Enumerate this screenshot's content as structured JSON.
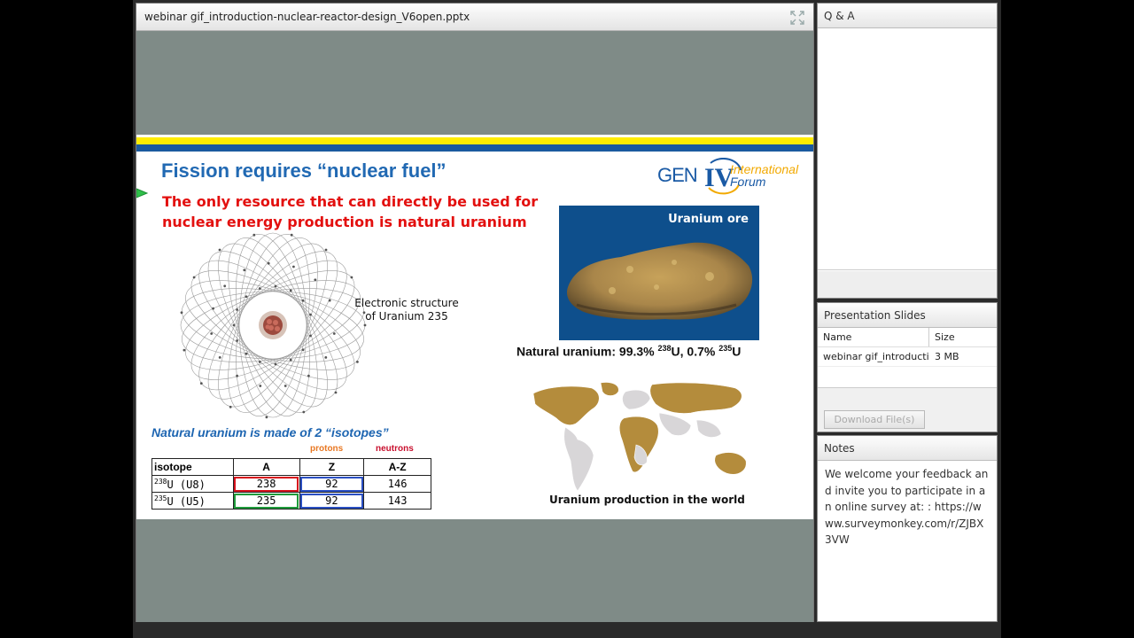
{
  "share_pod": {
    "title": "webinar gif_introduction-nuclear-reactor-design_V6open.pptx"
  },
  "slide": {
    "title": "Fission requires “nuclear fuel”",
    "subtitle": "The only resource that can directly be used for nuclear energy production is natural uranium",
    "logo": {
      "gen": "GEN",
      "roman": "IV",
      "line1": "International",
      "line2": "Forum"
    },
    "electronic_label_line1": "Electronic structure",
    "electronic_label_line2": "of Uranium 235",
    "ore_label": "Uranium ore",
    "natural_caption": {
      "prefix": "Natural uranium: 99.3% ",
      "iso1": "238",
      "mid": "U, 0.7% ",
      "iso2": "235",
      "suffix": "U"
    },
    "map_label": "Uranium production in the world",
    "isotopes_heading": "Natural uranium is made of 2 “isotopes”",
    "protons_hint": "protons",
    "neutrons_hint": "neutrons",
    "table": {
      "headers": [
        "isotope",
        "A",
        "Z",
        "A-Z"
      ],
      "rows": [
        {
          "mass": "238",
          "label": "U (U8)",
          "A": "238",
          "Z": "92",
          "N": "146"
        },
        {
          "mass": "235",
          "label": "U (U5)",
          "A": "235",
          "Z": "92",
          "N": "143"
        }
      ]
    }
  },
  "qa_pod": {
    "title": "Q & A"
  },
  "slides_pod": {
    "title": "Presentation Slides",
    "columns": [
      "Name",
      "Size"
    ],
    "file": {
      "name": "webinar gif_introductior",
      "size": "3 MB"
    },
    "download_label": "Download File(s)"
  },
  "notes_pod": {
    "title": "Notes",
    "text": "We welcome your feedback and invite you to participate in an online survey at: : https://www.surveymonkey.com/r/ZJBX3VW"
  },
  "colors": {
    "slide_title": "#2169b3",
    "slide_subtitle": "#e3100f",
    "band_yellow": "#ffed00",
    "band_blue": "#1a5a9f",
    "stage_bg": "#7f8b87"
  }
}
